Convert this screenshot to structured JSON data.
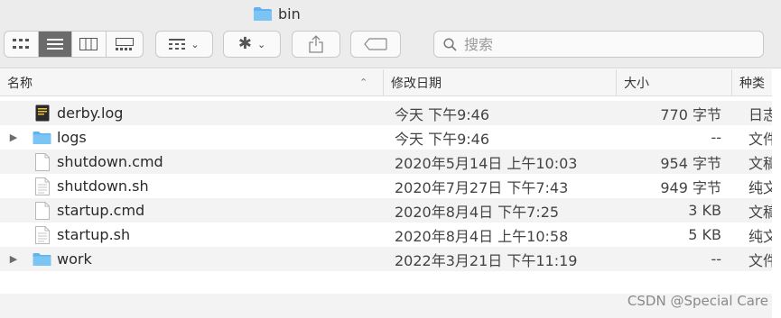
{
  "window": {
    "title": "bin"
  },
  "toolbar": {
    "view_modes": [
      "icon-view",
      "list-view",
      "column-view",
      "gallery-view"
    ],
    "active_view": "list-view",
    "group_icon": "group-icon",
    "action_icon": "gear-icon",
    "share_icon": "share-icon",
    "tag_icon": "tag-icon"
  },
  "search": {
    "placeholder": "搜索"
  },
  "columns": {
    "name": "名称",
    "date": "修改日期",
    "size": "大小",
    "kind": "种类"
  },
  "files": [
    {
      "name": "derby.log",
      "date": "今天 下午9:46",
      "size": "770 字节",
      "kind": "日志",
      "icon": "log-file-icon",
      "is_folder": false
    },
    {
      "name": "logs",
      "date": "今天 下午9:46",
      "size": "--",
      "kind": "文件夹",
      "icon": "folder-icon",
      "is_folder": true
    },
    {
      "name": "shutdown.cmd",
      "date": "2020年5月14日 上午10:03",
      "size": "954 字节",
      "kind": "文稿",
      "icon": "document-icon",
      "is_folder": false
    },
    {
      "name": "shutdown.sh",
      "date": "2020年7月27日 下午7:43",
      "size": "949 字节",
      "kind": "纯文本",
      "icon": "text-file-icon",
      "is_folder": false
    },
    {
      "name": "startup.cmd",
      "date": "2020年8月4日 下午7:25",
      "size": "3 KB",
      "kind": "文稿",
      "icon": "document-icon",
      "is_folder": false
    },
    {
      "name": "startup.sh",
      "date": "2020年8月4日 上午10:58",
      "size": "5 KB",
      "kind": "纯文本",
      "icon": "text-file-icon",
      "is_folder": false
    },
    {
      "name": "work",
      "date": "2022年3月21日 下午11:19",
      "size": "--",
      "kind": "文件夹",
      "icon": "folder-icon",
      "is_folder": true
    }
  ],
  "watermark": "CSDN @Special Care",
  "colors": {
    "folder": "#5fb4f0",
    "toolbar_bg": "#ececec",
    "row_alt": "#f3f3f3",
    "active_button": "#6b6b6b"
  }
}
